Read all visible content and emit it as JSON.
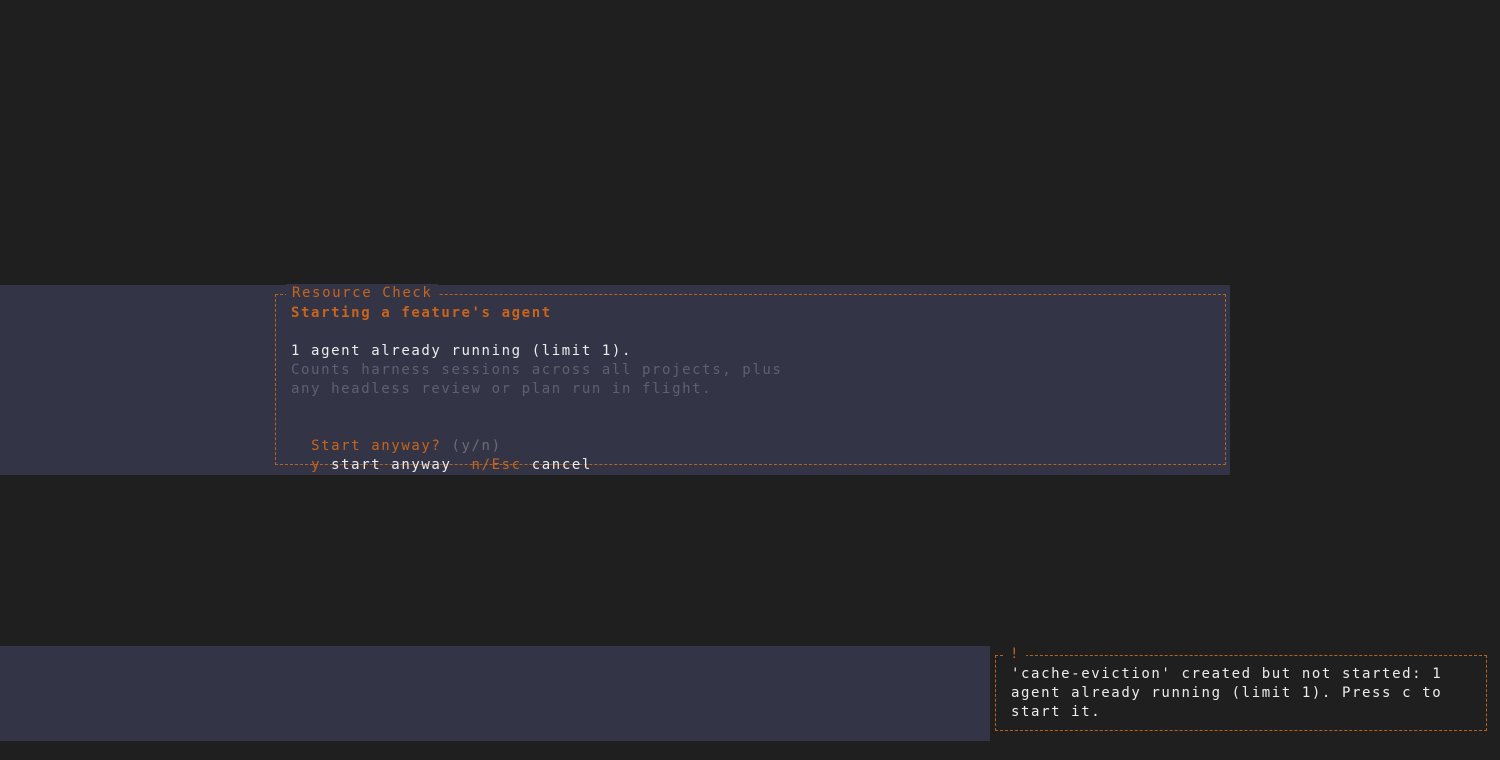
{
  "dialog": {
    "title": "Resource Check",
    "heading": "Starting a feature's agent",
    "status": "1 agent already running (limit 1).",
    "note_line1": "Counts harness sessions across all projects, plus",
    "note_line2": "any headless review or plan run in flight.",
    "question": "Start anyway?",
    "question_hint": "(y/n)",
    "confirm_key": "y",
    "confirm_label": "start anyway",
    "cancel_key": "n/Esc",
    "cancel_label": "cancel"
  },
  "toast": {
    "title": "!",
    "line1": "'cache-eviction' created but not started: 1",
    "line2": "agent already running (limit 1). Press c to",
    "line3": "start it."
  },
  "colors": {
    "background": "#1f1f1f",
    "panel": "#333546",
    "accent": "#c8641c",
    "text": "#ececec",
    "muted": "#5e6072"
  }
}
